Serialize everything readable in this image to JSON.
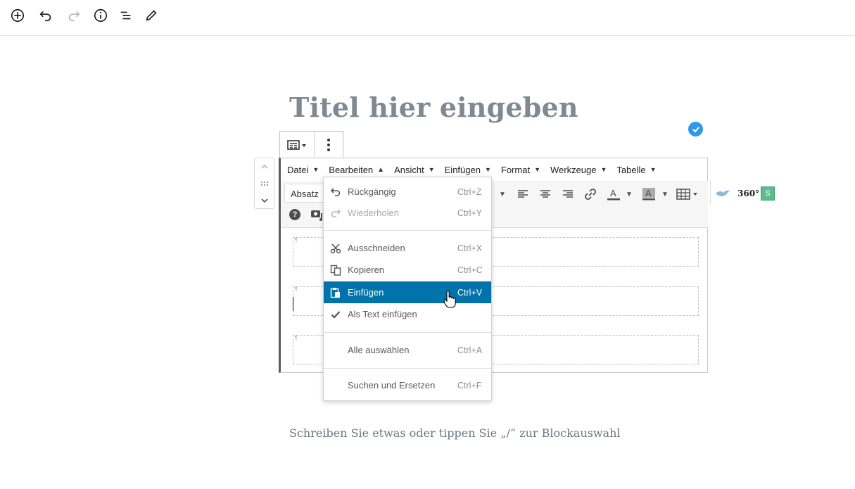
{
  "topbar": {
    "icons": [
      "add-block-icon",
      "undo-icon",
      "redo-icon",
      "info-icon",
      "outline-icon",
      "edit-icon"
    ]
  },
  "title": "Titel hier eingeben",
  "editor": {
    "menubar": [
      "Datei",
      "Bearbeiten",
      "Ansicht",
      "Einfügen",
      "Format",
      "Werkzeuge",
      "Tabelle"
    ],
    "format_select": "Absatz",
    "ext_360": "360°",
    "ext_s": "S"
  },
  "dropdown": {
    "items": [
      {
        "label": "Rückgängig",
        "shortcut": "Ctrl+Z",
        "icon": "undo-icon",
        "state": "normal"
      },
      {
        "label": "Wiederholen",
        "shortcut": "Ctrl+Y",
        "icon": "redo-icon",
        "state": "disabled"
      },
      {
        "label": "Ausschneiden",
        "shortcut": "Ctrl+X",
        "icon": "scissors-icon",
        "state": "normal"
      },
      {
        "label": "Kopieren",
        "shortcut": "Ctrl+C",
        "icon": "copy-icon",
        "state": "normal"
      },
      {
        "label": "Einfügen",
        "shortcut": "Ctrl+V",
        "icon": "paste-icon",
        "state": "highlight"
      },
      {
        "label": "Als Text einfügen",
        "shortcut": "",
        "icon": "checkmark-icon",
        "state": "normal"
      },
      {
        "label": "Alle auswählen",
        "shortcut": "Ctrl+A",
        "icon": "",
        "state": "normal"
      },
      {
        "label": "Suchen und Ersetzen",
        "shortcut": "Ctrl+F",
        "icon": "",
        "state": "normal"
      }
    ]
  },
  "placeholder": "Schreiben Sie etwas oder tippen Sie „/“ zur Blockauswahl",
  "colors": {
    "highlight": "#0073aa",
    "title": "#7e8993",
    "badge": "#2f98e8",
    "s_button": "#5dbb8f"
  }
}
